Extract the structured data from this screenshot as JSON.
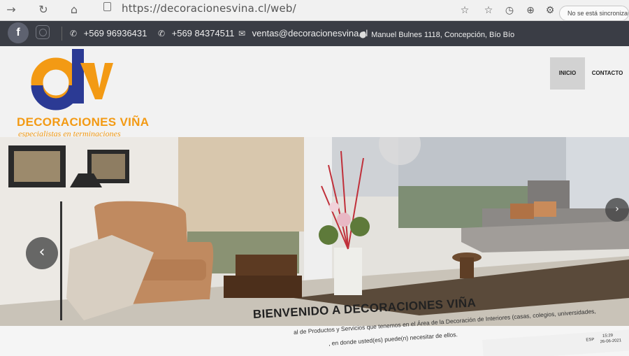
{
  "browser": {
    "url": "https://decoracionesvina.cl/web/",
    "sync_label": "No se está sincronizando"
  },
  "topbar": {
    "phone1": "+569 96936431",
    "phone2": "+569 84374511",
    "email": "ventas@decoracionesvina.cl",
    "address": "Manuel Bulnes 1118, Concepción, Bío Bío"
  },
  "logo": {
    "name": "DECORACIONES VIÑA",
    "tagline": "especialistas en terminaciones",
    "colors": {
      "orange": "#f39a14",
      "blue": "#2b3a94"
    }
  },
  "menu": {
    "items": [
      {
        "label": "INICIO",
        "active": true
      },
      {
        "label": "CONTACTO",
        "active": false
      }
    ]
  },
  "welcome": {
    "title": "BIENVENIDO A DECORACIONES VIÑA",
    "line1": "al de Productos y Servicios que tenemos en el Área de la Decoración de Interiores (casas, colegios, universidades,",
    "line2": ", en donde usted(es) puede(n) necesitar de ellos."
  },
  "taskbar": {
    "lang": "ESP",
    "time": "15:29",
    "date": "26-06-2021"
  },
  "icons": {
    "facebook": "facebook-icon",
    "instagram": "instagram-icon",
    "phone": "phone-icon",
    "email": "envelope-icon",
    "location": "map-pin-icon"
  }
}
